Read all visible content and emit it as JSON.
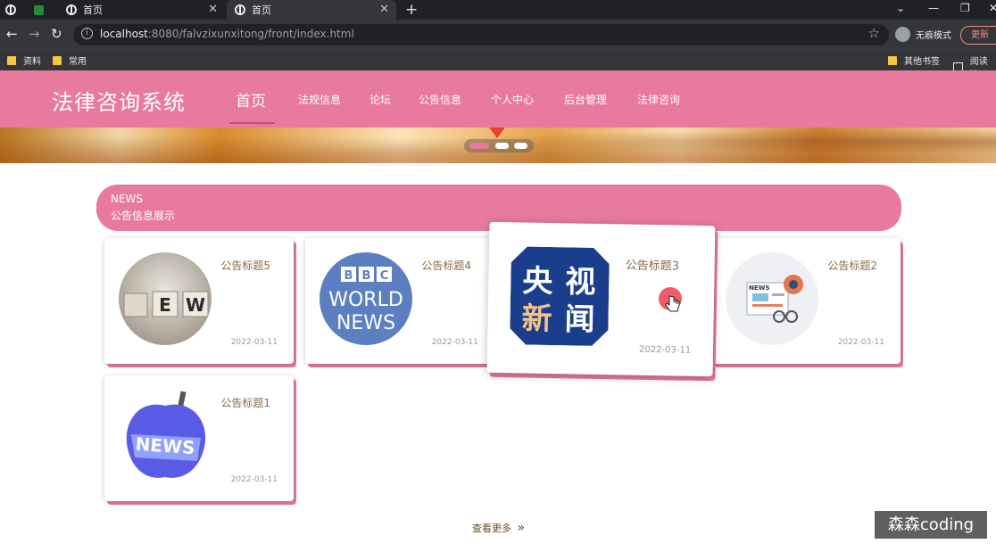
{
  "browser": {
    "tabs": [
      {
        "label": ""
      },
      {
        "label": ""
      },
      {
        "label": "首页"
      },
      {
        "label": "首页"
      }
    ],
    "new_tab": "+",
    "window_controls": [
      "⌄",
      "—",
      "❐",
      "✕"
    ],
    "url_host": "localhost",
    "url_rest": ":8080/falvzixunxitong/front/index.html",
    "incognito_label": "无痕模式",
    "update_label": "更新",
    "bookmarks": [
      {
        "label": "资料"
      },
      {
        "label": "常用"
      }
    ],
    "bookmarks_right": [
      {
        "label": "其他书签"
      },
      {
        "label": "阅读清"
      }
    ]
  },
  "site": {
    "logo": "法律咨询系统",
    "nav": [
      {
        "label": "首页",
        "active": true
      },
      {
        "label": "法规信息"
      },
      {
        "label": "论坛"
      },
      {
        "label": "公告信息"
      },
      {
        "label": "个人中心"
      },
      {
        "label": "后台管理"
      },
      {
        "label": "法律咨询"
      }
    ],
    "news_section": {
      "label_en": "NEWS",
      "label_cn": "公告信息展示"
    },
    "cards": [
      {
        "title": "公告标题5",
        "date": "2022-03-11",
        "image": "ew-blocks"
      },
      {
        "title": "公告标题4",
        "date": "2022-03-11",
        "image": "bbc-world-news"
      },
      {
        "title": "公告标题3",
        "date": "2022-03-11",
        "image": "cctv-news"
      },
      {
        "title": "公告标题2",
        "date": "2022-03-11",
        "image": "news-illustration"
      },
      {
        "title": "公告标题1",
        "date": "2022-03-11",
        "image": "news-apple"
      }
    ],
    "bbc_text": [
      "B",
      "B",
      "C",
      "WORLD",
      "NEWS"
    ],
    "cctv_text": [
      "央",
      "视",
      "新",
      "闻"
    ],
    "ew_text": [
      "E",
      "W"
    ],
    "news_badge": "NEWS",
    "more_label": "查看更多",
    "more_icon": "»",
    "watermark": "森森coding"
  },
  "colors": {
    "brand_pink": "#e77a9d",
    "chrome_dark": "#202124",
    "chrome_mid": "#35363a"
  }
}
